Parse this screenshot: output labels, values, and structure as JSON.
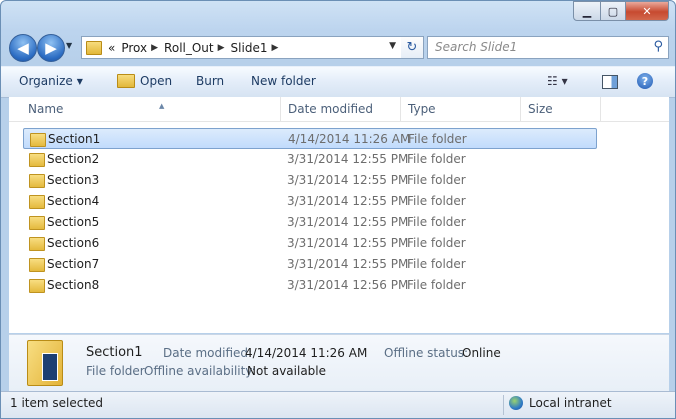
{
  "window": {
    "controls": {
      "minimize": "▁",
      "maximize": "▢",
      "close": "✕"
    }
  },
  "nav": {
    "back_glyph": "◀",
    "forward_glyph": "▶",
    "recent_glyph": "▼"
  },
  "address": {
    "overflow": "«",
    "crumbs": [
      "Prox",
      "Roll_Out",
      "Slide1"
    ],
    "separator": "▶",
    "dropdown": "▼",
    "refresh_glyph": "↻"
  },
  "search": {
    "placeholder": "Search Slide1",
    "glyph": "⚲"
  },
  "toolbar": {
    "organize": "Organize",
    "open": "Open",
    "burn": "Burn",
    "new_folder": "New folder",
    "dropdown": "▼",
    "views_glyph": "☷ ▾",
    "help": "?"
  },
  "columns": {
    "name": "Name",
    "date_modified": "Date modified",
    "type": "Type",
    "size": "Size",
    "sort_caret": "▲"
  },
  "files": [
    {
      "name": "Section1",
      "date": "4/14/2014 11:26 AM",
      "type": "File folder",
      "selected": true
    },
    {
      "name": "Section2",
      "date": "3/31/2014 12:55 PM",
      "type": "File folder"
    },
    {
      "name": "Section3",
      "date": "3/31/2014 12:55 PM",
      "type": "File folder"
    },
    {
      "name": "Section4",
      "date": "3/31/2014 12:55 PM",
      "type": "File folder"
    },
    {
      "name": "Section5",
      "date": "3/31/2014 12:55 PM",
      "type": "File folder"
    },
    {
      "name": "Section6",
      "date": "3/31/2014 12:55 PM",
      "type": "File folder"
    },
    {
      "name": "Section7",
      "date": "3/31/2014 12:55 PM",
      "type": "File folder"
    },
    {
      "name": "Section8",
      "date": "3/31/2014 12:56 PM",
      "type": "File folder"
    }
  ],
  "details": {
    "name": "Section1",
    "type": "File folder",
    "date_label": "Date modified:",
    "date_value": "4/14/2014 11:26 AM",
    "offline_status_label": "Offline status:",
    "offline_status_value": "Online",
    "offline_availability_label": "Offline availability:",
    "offline_availability_value": "Not available"
  },
  "status": {
    "selection": "1 item selected",
    "zone": "Local intranet"
  },
  "colors": {
    "selection": "#c1dbfc",
    "accent": "#1e3c64"
  }
}
